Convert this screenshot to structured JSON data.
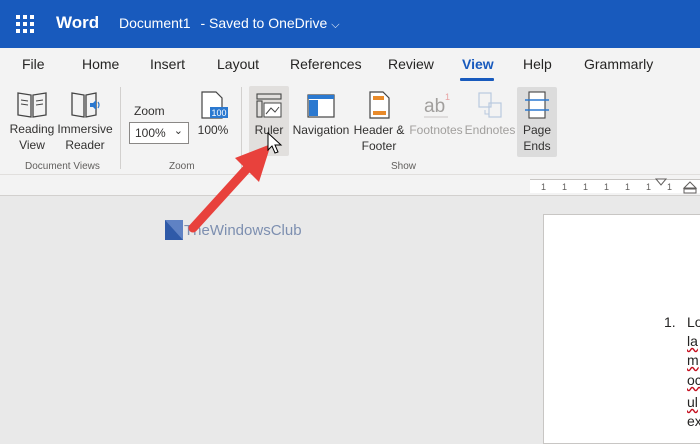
{
  "title_bar": {
    "app_name": "Word",
    "document_title": "Document1",
    "save_status": "-  Saved to OneDrive",
    "chevron": "⌵",
    "bg_color": "#185abd"
  },
  "tabs": [
    {
      "label": "File"
    },
    {
      "label": "Home"
    },
    {
      "label": "Insert"
    },
    {
      "label": "Layout"
    },
    {
      "label": "References"
    },
    {
      "label": "Review"
    },
    {
      "label": "View",
      "active": true
    },
    {
      "label": "Help"
    },
    {
      "label": "Grammarly"
    }
  ],
  "ribbon": {
    "document_views": {
      "group_label": "Document Views",
      "reading_view": "Reading\nView",
      "immersive_reader": "Immersive\nReader"
    },
    "zoom": {
      "group_label": "Zoom",
      "zoom_label": "Zoom",
      "zoom_value": "100%",
      "hundred_percent_label": "100%",
      "hundred_icon_text": "100"
    },
    "show": {
      "group_label": "Show",
      "ruler": "Ruler",
      "navigation": "Navigation",
      "header_footer": "Header &\nFooter",
      "footnotes": "Footnotes",
      "endnotes": "Endnotes",
      "page_ends": "Page\nEnds"
    }
  },
  "ruler": {
    "numbers": [
      "1",
      "1",
      "1",
      "1",
      "1",
      "1",
      "1"
    ]
  },
  "document": {
    "list_number": "1.",
    "lines": [
      "Lo",
      "la",
      "m",
      "oc",
      "ul",
      "ex"
    ]
  },
  "watermark": {
    "text": "TheWindowsClub"
  },
  "annotation": {
    "arrow_color": "#e8413c"
  },
  "icons": {
    "app_launcher": "waffle-icon",
    "reading_view": "book-icon",
    "immersive_reader": "reader-speaker-icon",
    "hundred_percent": "page-100-icon",
    "ruler": "ruler-icon",
    "navigation": "navigation-pane-icon",
    "header_footer": "header-footer-icon",
    "footnotes": "footnote-icon",
    "endnotes": "endnote-icon",
    "page_ends": "page-ends-icon"
  }
}
